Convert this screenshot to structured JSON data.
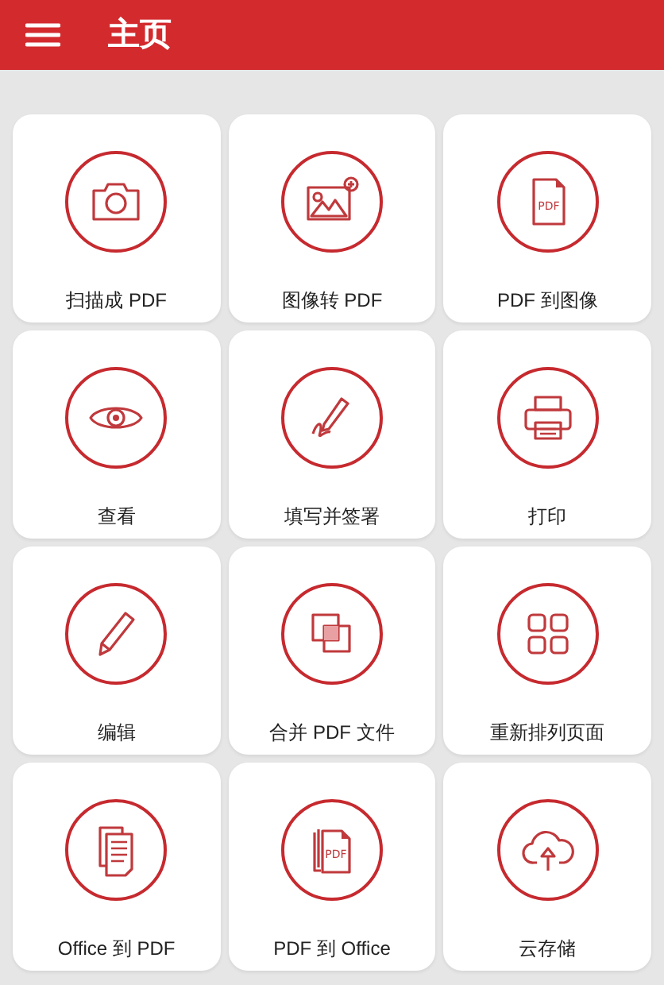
{
  "app_bar": {
    "title": "主页"
  },
  "tools": [
    {
      "kind": "camera",
      "label": "扫描成 PDF"
    },
    {
      "kind": "image",
      "label": "图像转 PDF"
    },
    {
      "kind": "file",
      "icon_text": "PDF",
      "label": "PDF 到图像"
    },
    {
      "kind": "eye",
      "label": "查看"
    },
    {
      "kind": "signature",
      "label": "填写并签署"
    },
    {
      "kind": "printer",
      "label": "打印"
    },
    {
      "kind": "pencil",
      "label": "编辑"
    },
    {
      "kind": "merge",
      "label": "合并 PDF 文件"
    },
    {
      "kind": "grid",
      "label": "重新排列页面"
    },
    {
      "kind": "documents",
      "label": "Office 到 PDF"
    },
    {
      "kind": "files",
      "icon_text": "PDF",
      "label": "PDF 到 Office"
    },
    {
      "kind": "cloud",
      "label": "云存储"
    }
  ]
}
